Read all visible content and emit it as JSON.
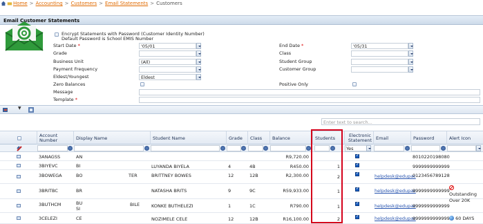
{
  "breadcrumb": {
    "home": "Home",
    "items": [
      "Accounting",
      "Customers",
      "Email Statements"
    ],
    "current": "Customers",
    "separator": ">"
  },
  "panel": {
    "title": "Email Customer Statements"
  },
  "options": {
    "encrypt_label_1": "Encrypt Statements with Password (Customer Identity Number)",
    "encrypt_label_2": "Default Password is School EMIS Number"
  },
  "form": {
    "start_date_label": "Start Date",
    "start_date_value": "'05/01",
    "end_date_label": "End Date",
    "end_date_value": "'05/31",
    "grade_label": "Grade",
    "class_label": "Class",
    "business_unit_label": "Business Unit",
    "business_unit_value": "(All)",
    "student_group_label": "Student Group",
    "payment_frequency_label": "Payment Frequency",
    "customer_group_label": "Customer Group",
    "eldest_label": "Eldest/Youngest",
    "eldest_value": "Eldest",
    "zero_balances_label": "Zero Balances",
    "positive_only_label": "Positive Only",
    "message_label": "Message",
    "template_label": "Template",
    "required_mark": "*"
  },
  "search": {
    "placeholder": "Enter text to search..."
  },
  "columns": {
    "account_number": "Account Number",
    "display_name": "Display Name",
    "student_name": "Student Name",
    "grade": "Grade",
    "class": "Class",
    "balance": "Balance",
    "students": "Students",
    "electronic_statement": "Electronic Statement",
    "email": "Email",
    "password": "Password",
    "alert_icon": "Alert Icon"
  },
  "filters": {
    "electronic_statement": "Yes"
  },
  "rows": [
    {
      "account": "3ANAGSS",
      "display": "AN",
      "student": "",
      "grade": "",
      "class": "",
      "balance": "R9,720.00",
      "students": "",
      "email": "",
      "password": "8010220198080",
      "alert": ""
    },
    {
      "account": "3BIYEVC",
      "display": "BI",
      "student": "LUYANDA BIYELA",
      "grade": "4",
      "class": "4B",
      "balance": "R450.00",
      "students": "1",
      "email": "",
      "password": "9999999999999",
      "alert": ""
    },
    {
      "account": "3BOWEGA",
      "display": "BO",
      "display_suffix": "TER",
      "student": "BRITTNEY BOWES",
      "grade": "12",
      "class": "12B",
      "balance": "R2,300.00",
      "students": "2",
      "email": "helpdesk@edupac",
      "password": "0123456789128",
      "alert": ""
    },
    {
      "account": "3BRITBC",
      "display": "BR",
      "student": "NATASHA BRITS",
      "grade": "9",
      "class": "9C",
      "balance": "R59,933.00",
      "students": "1",
      "email": "helpdesk@edupac",
      "password": "9999999999999",
      "alert": "Outstanding Over 20K"
    },
    {
      "account": "3BUTHCM",
      "display": "BU",
      "display_line2": "SI",
      "display_suffix": "BILE",
      "student": "KONKE BUTHELEZI",
      "grade": "1",
      "class": "1C",
      "balance": "R790.00",
      "students": "1",
      "email": "helpdesk@edupac",
      "password": "9999999999999",
      "alert": ""
    },
    {
      "account": "3CELEZI",
      "display": "CE",
      "student": "NOZIMELE CELE",
      "grade": "12",
      "class": "12B",
      "balance": "R16,100.00",
      "students": "2",
      "email": "helpdesk@edupac",
      "password": "9999999999999",
      "alert": "60 DAYS"
    }
  ],
  "colors": {
    "accent_orange": "#e06a00",
    "highlight_red": "#d4001a",
    "header_blue": "#cddbea"
  }
}
